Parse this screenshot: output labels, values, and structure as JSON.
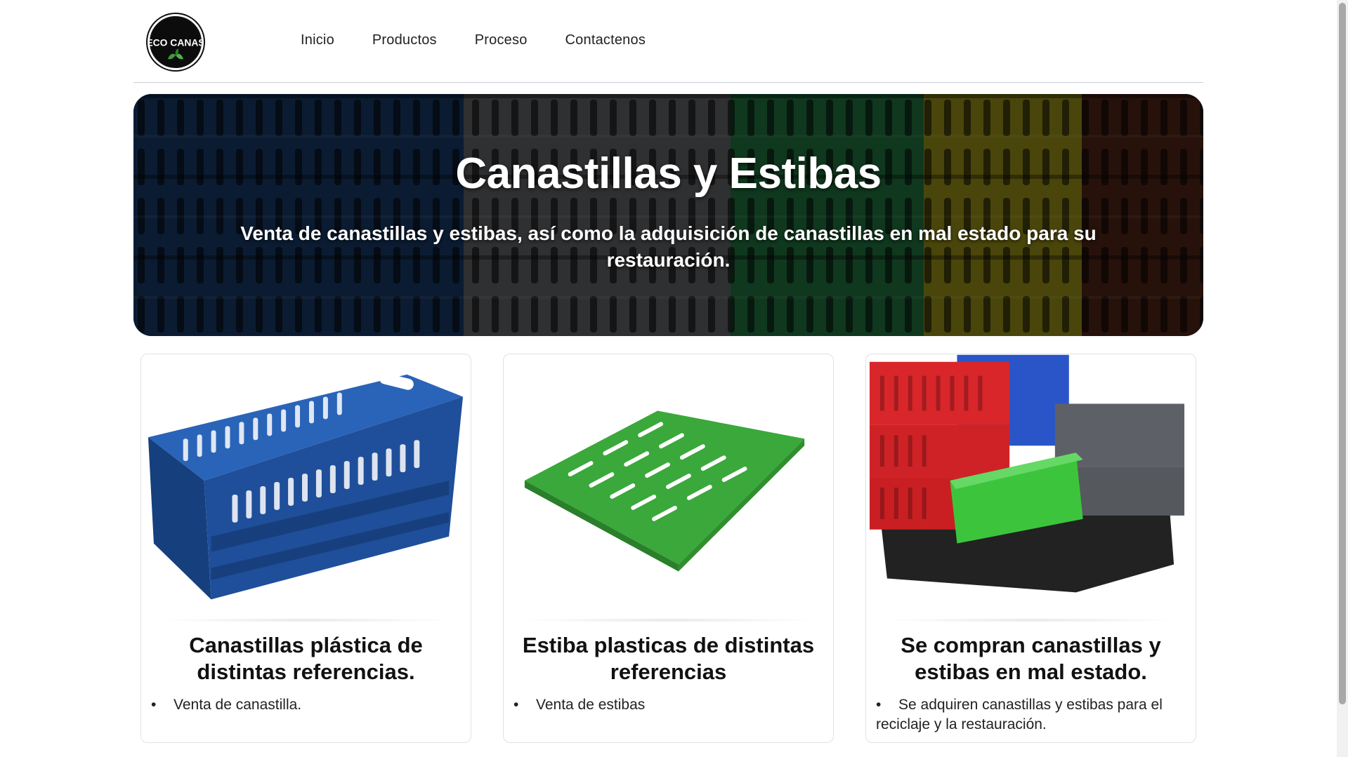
{
  "brand": {
    "logo_text": "ECO CANAS"
  },
  "nav": {
    "items": [
      {
        "label": "Inicio"
      },
      {
        "label": "Productos"
      },
      {
        "label": "Proceso"
      },
      {
        "label": "Contactenos"
      }
    ]
  },
  "hero": {
    "title": "Canastillas y Estibas",
    "subtitle": "Venta de canastillas y estibas, así como la adquisición de canastillas en mal estado para su restauración."
  },
  "cards": [
    {
      "title": "Canastillas plástica de distintas referencias.",
      "bullets": [
        "Venta de canastilla."
      ],
      "image_name": "blue-crate-image"
    },
    {
      "title": "Estiba plasticas de distintas referencias",
      "bullets": [
        "Venta de estibas"
      ],
      "image_name": "green-pallet-image"
    },
    {
      "title": "Se compran canastillas y estibas en mal estado.",
      "bullets": [
        "Se adquiren canastillas y estibas para el reciclaje y la restauración."
      ],
      "image_name": "stacked-crates-image"
    }
  ],
  "colors": {
    "crate_blue": "#1f4f9a",
    "pallet_green": "#3aa83a",
    "crate_red": "#d9262a",
    "crate_gray": "#595d63"
  }
}
